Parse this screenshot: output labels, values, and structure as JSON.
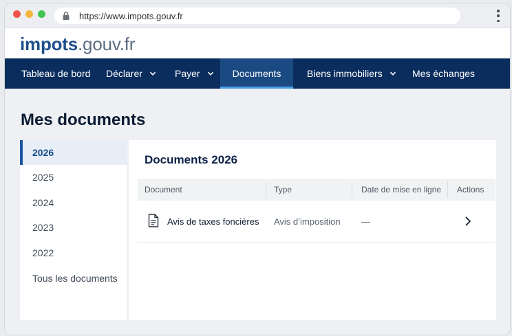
{
  "browser": {
    "url": "https://www.impots.gouv.fr"
  },
  "site": {
    "logo_primary": "impots",
    "logo_secondary": ".gouv.fr"
  },
  "nav": {
    "items": [
      {
        "label": "Tableau de bord",
        "dropdown": false,
        "active": false
      },
      {
        "label": "Déclarer",
        "dropdown": true,
        "active": false
      },
      {
        "label": "Payer",
        "dropdown": true,
        "active": false
      },
      {
        "label": "Documents",
        "dropdown": false,
        "active": true
      },
      {
        "label": "Biens immobiliers",
        "dropdown": true,
        "active": false
      },
      {
        "label": "Mes échanges",
        "dropdown": false,
        "active": false
      }
    ]
  },
  "page": {
    "title": "Mes documents"
  },
  "sidebar": {
    "items": [
      {
        "label": "2026",
        "active": true
      },
      {
        "label": "2025",
        "active": false
      },
      {
        "label": "2024",
        "active": false
      },
      {
        "label": "2023",
        "active": false
      },
      {
        "label": "2022",
        "active": false
      },
      {
        "label": "Tous les documents",
        "active": false
      }
    ]
  },
  "panel": {
    "title": "Documents 2026",
    "columns": [
      "Document",
      "Type",
      "Date de mise en ligne",
      "Actions"
    ],
    "rows": [
      {
        "document": "Avis de taxes foncières",
        "type": "Avis d’imposition",
        "date": "—",
        "icon": "document-icon",
        "action_icon": "chevron-right-icon"
      }
    ]
  },
  "colors": {
    "nav_bg": "#0b2d5e",
    "nav_active": "#1b4a82",
    "accent": "#1b55a0",
    "logo_primary": "#1d4f8c"
  }
}
